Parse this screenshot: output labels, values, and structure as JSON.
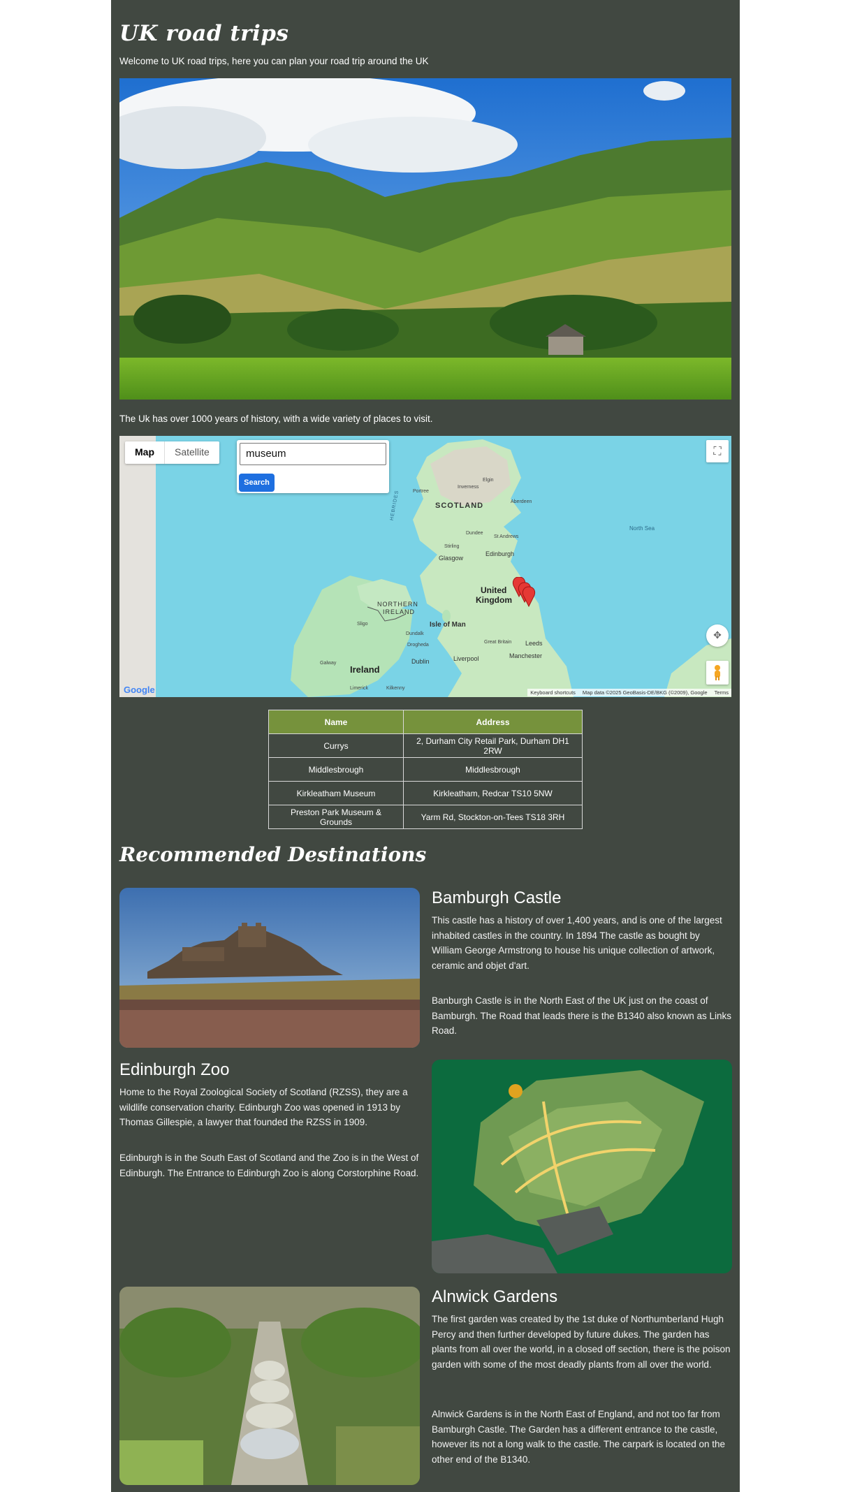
{
  "site": {
    "title": "UK road trips",
    "intro": "Welcome to UK road trips, here you can plan your road trip around the UK",
    "history": "The Uk has over 1000 years of history, with a wide variety of places to visit."
  },
  "map": {
    "type_map_label": "Map",
    "type_satellite_label": "Satellite",
    "search_value": "museum",
    "search_button": "Search",
    "google_logo": "Google",
    "attribution": {
      "shortcuts": "Keyboard shortcuts",
      "data": "Map data ©2025 GeoBasis-DE/BKG (©2009), Google",
      "terms": "Terms"
    },
    "labels": {
      "scotland": "SCOTLAND",
      "united_kingdom_1": "United",
      "united_kingdom_2": "Kingdom",
      "northern_ireland_1": "NORTHERN",
      "northern_ireland_2": "IRELAND",
      "isle_of_man": "Isle of Man",
      "ireland": "Ireland",
      "hebrides": "HEBRIDES",
      "north_sea": "North Sea",
      "edinburgh": "Edinburgh",
      "glasgow": "Glasgow",
      "dundee": "Dundee",
      "aberdeen": "Aberdeen",
      "inverness": "Inverness",
      "stirling": "Stirling",
      "st_andrews": "St Andrews",
      "elgin": "Elgin",
      "portree": "Portree",
      "dublin": "Dublin",
      "liverpool": "Liverpool",
      "manchester": "Manchester",
      "leeds": "Leeds",
      "great_britain": "Great Britain",
      "sligo": "Sligo",
      "galway": "Galway",
      "dundalk": "Dundalk",
      "drogheda": "Drogheda",
      "limerick": "Limerick",
      "kilkenny": "Kilkenny"
    },
    "marker_color": "#e53935"
  },
  "results_table": {
    "headers": [
      "Name",
      "Address"
    ],
    "rows": [
      [
        "Currys",
        "2, Durham City Retail Park, Durham DH1 2RW"
      ],
      [
        "Middlesbrough",
        "Middlesbrough"
      ],
      [
        "Kirkleatham Museum",
        "Kirkleatham, Redcar TS10 5NW"
      ],
      [
        "Preston Park Museum & Grounds",
        "Yarm Rd, Stockton-on-Tees TS18 3RH"
      ]
    ]
  },
  "recommended": {
    "title": "Recommended Destinations",
    "destinations": [
      {
        "name": "Bamburgh Castle",
        "para1": "This castle has a history of over 1,400 years, and is one of the largest inhabited castles in the country. In 1894 The castle as bought by William George Armstrong to house his unique collection of artwork, ceramic and objet d'art.",
        "para2": "Banburgh Castle is in the North East of the UK just on the coast of Bamburgh. The Road that leads there is the B1340 also known as Links Road."
      },
      {
        "name": "Edinburgh Zoo",
        "para1": "Home to the Royal Zoological Society of Scotland (RZSS), they are a wildlife conservation charity. Edinburgh Zoo was opened in 1913 by Thomas Gillespie, a lawyer that founded the RZSS in 1909.",
        "para2": "Edinburgh is in the South East of Scotland and the Zoo is in the West of Edinburgh. The Entrance to Edinburgh Zoo is along Corstorphine Road."
      },
      {
        "name": "Alnwick Gardens",
        "para1": "The first garden was created by the 1st duke of Northumberland Hugh Percy and then further developed by future dukes. The garden has plants from all over the world, in a closed off section, there is the poison garden with some of the most deadly plants from all over the world.",
        "para2": "Alnwick Gardens is in the North East of England, and not too far from Bamburgh Castle. The Garden has a different entrance to the castle, however its not a long walk to the castle. The carpark is located on the other end of the B1340."
      }
    ]
  },
  "colors": {
    "page_bg": "#414841",
    "table_header": "#76923c",
    "search_button": "#1e6fe0"
  }
}
